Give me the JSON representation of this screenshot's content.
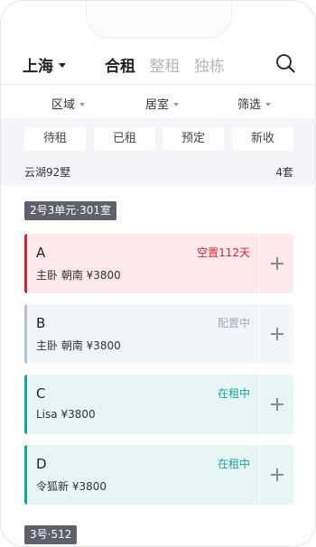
{
  "header": {
    "city": "上海",
    "tabs": [
      {
        "label": "合租",
        "active": true
      },
      {
        "label": "整租",
        "active": false
      },
      {
        "label": "独栋",
        "active": false
      }
    ]
  },
  "filters": [
    {
      "label": "区域"
    },
    {
      "label": "居室"
    },
    {
      "label": "筛选"
    }
  ],
  "status_chips": [
    "待租",
    "已租",
    "预定",
    "新收"
  ],
  "building": {
    "name": "云湖92墅",
    "count": "4套"
  },
  "units": [
    {
      "label": "2号3单元·301室",
      "rooms": [
        {
          "name": "A",
          "detail": "主卧  朝南  ¥3800",
          "status": "空置112天",
          "style": "red"
        },
        {
          "name": "B",
          "detail": "主卧  朝南  ¥3800",
          "status": "配置中",
          "style": "blue"
        },
        {
          "name": "C",
          "detail": "Lisa ¥3800",
          "status": "在租中",
          "style": "teal"
        },
        {
          "name": "D",
          "detail": "令狐新 ¥3800",
          "status": "在租中",
          "style": "teal"
        }
      ]
    },
    {
      "label": "3号·512"
    }
  ],
  "colors": {
    "vacant": "#d6242f",
    "configuring": "#a5a9b0",
    "rented": "#1aa39b",
    "unit_tag_bg": "#5d6169"
  },
  "icons": {
    "search": "search-icon",
    "add": "plus-icon",
    "dropdown": "caret-down-icon"
  }
}
